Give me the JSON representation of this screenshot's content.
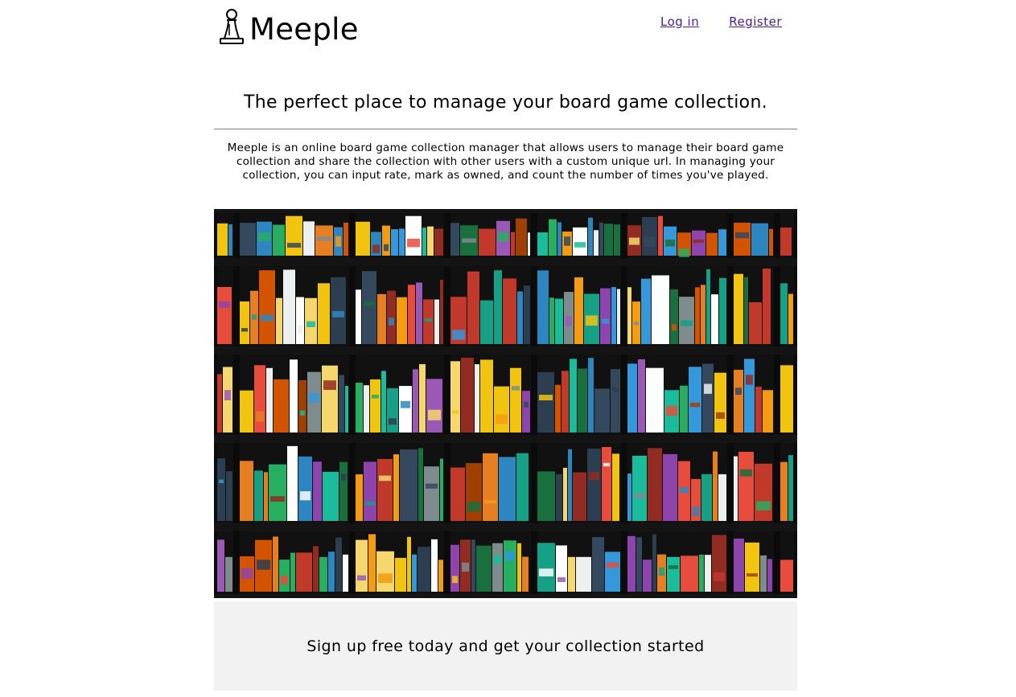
{
  "brand": {
    "name": "Meeple",
    "logo_icon": "pawn-icon"
  },
  "nav": {
    "login_label": "Log in",
    "register_label": "Register"
  },
  "hero": {
    "tagline": "The perfect place to manage your board game collection.",
    "description": "Meeple is an online board game collection manager that allows users to manage their board game collection and share the collection with other users with a custom unique url. In managing your collection, you can input rate, mark as owned, and count the number of times you've played.",
    "image_subject": "board-game-shelves-photo"
  },
  "cta": {
    "signup_text": "Sign up free today and get your collection started"
  },
  "colors": {
    "link": "#4b1e86",
    "divider": "#808080",
    "cta_background": "#f2f2f2",
    "shelf": "#101010"
  }
}
